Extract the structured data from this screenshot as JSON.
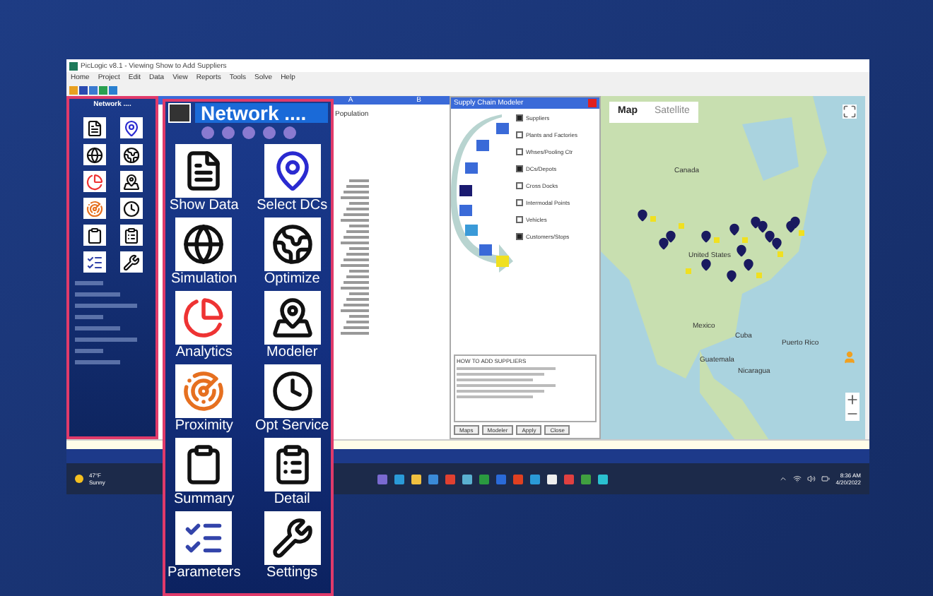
{
  "window": {
    "title": "PicLogic v8.1 - Viewing Show to Add Suppliers"
  },
  "menu": [
    "Home",
    "Project",
    "Edit",
    "Data",
    "View",
    "Reports",
    "Tools",
    "Solve",
    "Help"
  ],
  "sidebar": {
    "title": "Network ...."
  },
  "network_panel": {
    "title": "Network ....",
    "tiles": [
      {
        "label": "Show Data"
      },
      {
        "label": "Select DCs"
      },
      {
        "label": "Simulation"
      },
      {
        "label": "Optimize"
      },
      {
        "label": "Analytics"
      },
      {
        "label": "Modeler"
      },
      {
        "label": "Proximity"
      },
      {
        "label": "Opt Service"
      },
      {
        "label": "Summary"
      },
      {
        "label": "Detail"
      },
      {
        "label": "Parameters"
      },
      {
        "label": "Settings"
      }
    ]
  },
  "table": {
    "columns": [
      "A",
      "B"
    ],
    "heading": "Population"
  },
  "modeler": {
    "title": "Supply Chain Modeler",
    "layers": [
      {
        "label": "Suppliers",
        "checked": true
      },
      {
        "label": "Plants and Factories",
        "checked": false
      },
      {
        "label": "Whses/Pooling Ctr",
        "checked": false
      },
      {
        "label": "DCs/Depots",
        "checked": true
      },
      {
        "label": "Cross Docks",
        "checked": false
      },
      {
        "label": "Intermodal Points",
        "checked": false
      },
      {
        "label": "Vehicles",
        "checked": false
      },
      {
        "label": "Customers/Stops",
        "checked": true
      }
    ],
    "help_heading": "HOW TO ADD SUPPLIERS",
    "buttons": [
      "Maps",
      "Modeler",
      "Apply",
      "Close"
    ]
  },
  "map": {
    "tabs": [
      {
        "label": "Map",
        "selected": true
      },
      {
        "label": "Satellite",
        "selected": false
      }
    ],
    "places": [
      {
        "label": "Canada"
      },
      {
        "label": "United States"
      },
      {
        "label": "Mexico"
      },
      {
        "label": "Cuba"
      },
      {
        "label": "Puerto Rico"
      },
      {
        "label": "Guatemala"
      },
      {
        "label": "Nicaragua"
      }
    ]
  },
  "taskbar": {
    "temperature": "47°F",
    "weather": "Sunny",
    "time": "8:36 AM",
    "date": "4/20/2022"
  }
}
